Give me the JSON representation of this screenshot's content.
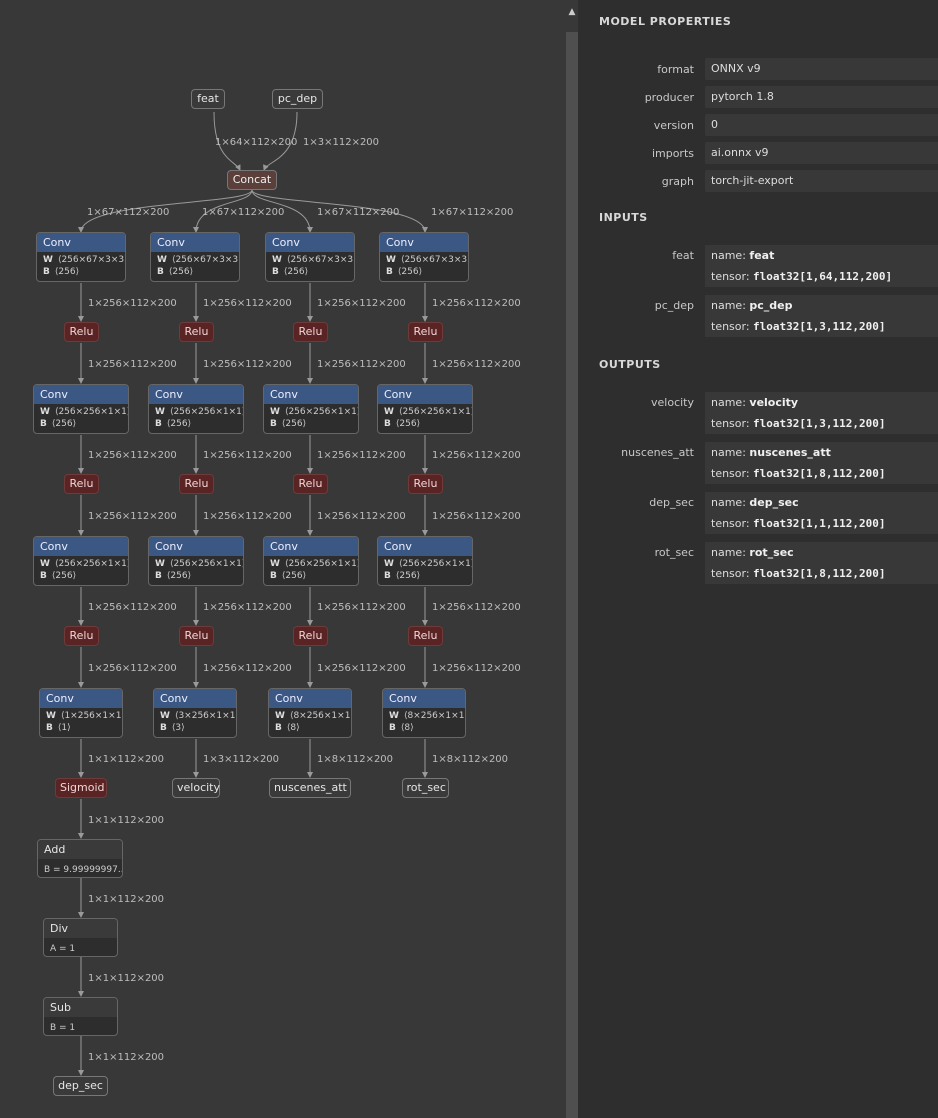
{
  "graph": {
    "top_inputs": [
      {
        "label": "feat",
        "shape": "1×64×112×200"
      },
      {
        "label": "pc_dep",
        "shape": "1×3×112×200"
      }
    ],
    "concat_label": "Concat",
    "concat_out_shape": "1×67×112×200",
    "branches": [
      {
        "conv1": {
          "label": "Conv",
          "W": "⟨256×67×3×3⟩",
          "B": "⟨256⟩"
        },
        "relu_label": "Relu",
        "mid_shape": "1×256×112×200",
        "conv2": {
          "label": "Conv",
          "W": "⟨256×256×1×1⟩",
          "B": "⟨256⟩"
        },
        "conv3": {
          "label": "Conv",
          "W": "⟨256×256×1×1⟩",
          "B": "⟨256⟩"
        },
        "conv4": {
          "label": "Conv",
          "W": "⟨1×256×1×1⟩",
          "B": "⟨1⟩"
        },
        "out_shape": "1×1×112×200",
        "out_label": "Sigmoid"
      },
      {
        "conv1": {
          "label": "Conv",
          "W": "⟨256×67×3×3⟩",
          "B": "⟨256⟩"
        },
        "relu_label": "Relu",
        "mid_shape": "1×256×112×200",
        "conv2": {
          "label": "Conv",
          "W": "⟨256×256×1×1⟩",
          "B": "⟨256⟩"
        },
        "conv3": {
          "label": "Conv",
          "W": "⟨256×256×1×1⟩",
          "B": "⟨256⟩"
        },
        "conv4": {
          "label": "Conv",
          "W": "⟨3×256×1×1⟩",
          "B": "⟨3⟩"
        },
        "out_shape": "1×3×112×200",
        "out_label": "velocity"
      },
      {
        "conv1": {
          "label": "Conv",
          "W": "⟨256×67×3×3⟩",
          "B": "⟨256⟩"
        },
        "relu_label": "Relu",
        "mid_shape": "1×256×112×200",
        "conv2": {
          "label": "Conv",
          "W": "⟨256×256×1×1⟩",
          "B": "⟨256⟩"
        },
        "conv3": {
          "label": "Conv",
          "W": "⟨256×256×1×1⟩",
          "B": "⟨256⟩"
        },
        "conv4": {
          "label": "Conv",
          "W": "⟨8×256×1×1⟩",
          "B": "⟨8⟩"
        },
        "out_shape": "1×8×112×200",
        "out_label": "nuscenes_att"
      },
      {
        "conv1": {
          "label": "Conv",
          "W": "⟨256×67×3×3⟩",
          "B": "⟨256⟩"
        },
        "relu_label": "Relu",
        "mid_shape": "1×256×112×200",
        "conv2": {
          "label": "Conv",
          "W": "⟨256×256×1×1⟩",
          "B": "⟨256⟩"
        },
        "conv3": {
          "label": "Conv",
          "W": "⟨256×256×1×1⟩",
          "B": "⟨256⟩"
        },
        "conv4": {
          "label": "Conv",
          "W": "⟨8×256×1×1⟩",
          "B": "⟨8⟩"
        },
        "out_shape": "1×8×112×200",
        "out_label": "rot_sec"
      }
    ],
    "tail": {
      "shape": "1×1×112×200",
      "add": {
        "label": "Add",
        "attr": "B = 9.99999997..."
      },
      "div": {
        "label": "Div",
        "attr": "A = 1"
      },
      "sub": {
        "label": "Sub",
        "attr": "B = 1"
      },
      "output_label": "dep_sec"
    },
    "attr_keys": {
      "w": "W",
      "b": "B"
    }
  },
  "sidebar": {
    "model_title": "MODEL PROPERTIES",
    "properties": [
      {
        "label": "format",
        "value": "ONNX v9"
      },
      {
        "label": "producer",
        "value": "pytorch 1.8"
      },
      {
        "label": "version",
        "value": "0"
      },
      {
        "label": "imports",
        "value": "ai.onnx v9"
      },
      {
        "label": "graph",
        "value": "torch-jit-export"
      }
    ],
    "inputs_title": "INPUTS",
    "inputs": [
      {
        "label": "feat",
        "name": "feat",
        "tensor": "float32[1,64,112,200]"
      },
      {
        "label": "pc_dep",
        "name": "pc_dep",
        "tensor": "float32[1,3,112,200]"
      }
    ],
    "outputs_title": "OUTPUTS",
    "outputs": [
      {
        "label": "velocity",
        "name": "velocity",
        "tensor": "float32[1,3,112,200]"
      },
      {
        "label": "nuscenes_att",
        "name": "nuscenes_att",
        "tensor": "float32[1,8,112,200]"
      },
      {
        "label": "dep_sec",
        "name": "dep_sec",
        "tensor": "float32[1,1,112,200]"
      },
      {
        "label": "rot_sec",
        "name": "rot_sec",
        "tensor": "float32[1,8,112,200]"
      }
    ],
    "name_prefix": "name: ",
    "tensor_prefix": "tensor: "
  },
  "colors": {
    "background": "#383838",
    "sidebar": "#2e2e2e",
    "conv_header": "#3b5784",
    "activation": "#5a2424",
    "concat": "#5a3f3a",
    "edge": "#9a9a9a"
  },
  "icons": {
    "collapse": "chevron-up-icon"
  }
}
